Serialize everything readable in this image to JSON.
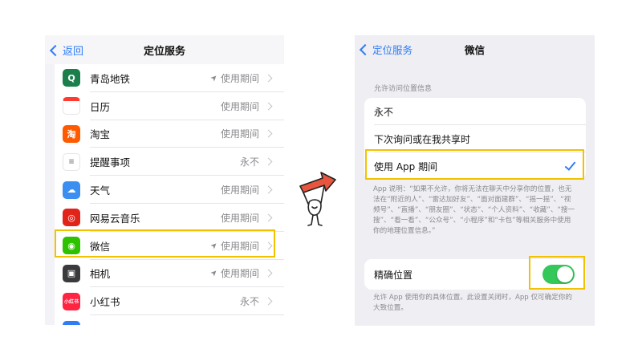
{
  "left_panel": {
    "back_label": "返回",
    "title": "定位服务",
    "apps": [
      {
        "name": "青岛地铁",
        "status": "使用期间",
        "icon": "qingdao-metro-icon",
        "color": "#1a7f4b",
        "glyph": "Q",
        "arrow": true
      },
      {
        "name": "日历",
        "status": "使用期间",
        "icon": "calendar-icon",
        "color": "#ffffff",
        "glyph": "",
        "arrow": false
      },
      {
        "name": "淘宝",
        "status": "使用期间",
        "icon": "taobao-icon",
        "color": "#ff5a00",
        "glyph": "淘",
        "arrow": false
      },
      {
        "name": "提醒事项",
        "status": "永不",
        "icon": "reminders-icon",
        "color": "#ffffff",
        "glyph": "",
        "arrow": false
      },
      {
        "name": "天气",
        "status": "使用期间",
        "icon": "weather-icon",
        "color": "#3b8ff0",
        "glyph": "☁",
        "arrow": false
      },
      {
        "name": "网易云音乐",
        "status": "使用期间",
        "icon": "netease-music-icon",
        "color": "#e2231a",
        "glyph": "◎",
        "arrow": false
      },
      {
        "name": "微信",
        "status": "使用期间",
        "icon": "wechat-icon",
        "color": "#2dc100",
        "glyph": "◉",
        "arrow": true
      },
      {
        "name": "相机",
        "status": "使用期间",
        "icon": "camera-icon",
        "color": "#3a3a3c",
        "glyph": "▣",
        "arrow": true
      },
      {
        "name": "小红书",
        "status": "永不",
        "icon": "xiaohongshu-icon",
        "color": "#ff2442",
        "glyph": "小红书",
        "arrow": false
      },
      {
        "name": "",
        "status": "",
        "icon": "partial-app-icon",
        "color": "#2f7cf6",
        "glyph": "",
        "arrow": false
      }
    ]
  },
  "right_panel": {
    "back_label": "定位服务",
    "title": "微信",
    "section_label": "允许访问位置信息",
    "options": [
      {
        "label": "永不",
        "checked": false
      },
      {
        "label": "下次询问或在我共享时",
        "checked": false
      },
      {
        "label": "使用 App 期间",
        "checked": true
      }
    ],
    "explanation": "App 说明：“如果不允许，你将无法在聊天中分享你的位置，也无法在“附近的人”、“雷达加好友”、“面对面建群”、“摇一摇”、“视频号”、“直播”、“朋友圈”、“状态”、“个人资料”、“收藏”、“搜一搜”、“看一看”、“公众号”、“小程序”和“卡包”等相关服务中使用你的地理位置信息。”",
    "precise_label": "精确位置",
    "precise_enabled": true,
    "precise_footer": "允许 App 使用你的具体位置。此设置关闭时，App 仅可确定你的大致位置。"
  },
  "colors": {
    "highlight": "#f2c200",
    "accent_blue": "#2f7cf6",
    "toggle_green": "#34c759",
    "arrow_red": "#e8553e"
  }
}
